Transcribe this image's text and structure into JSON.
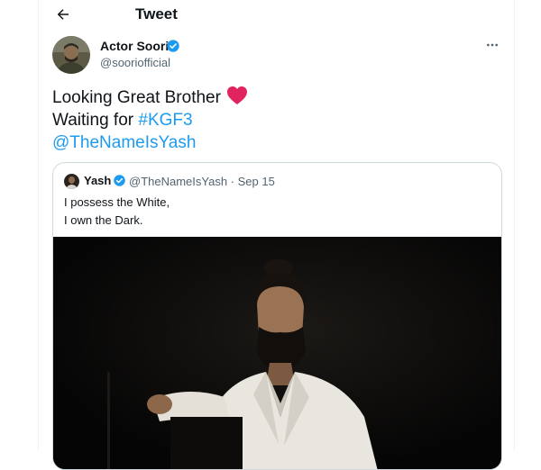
{
  "header": {
    "title": "Tweet",
    "back_icon": "arrow-left-icon"
  },
  "tweet": {
    "author_name": "Actor Soori",
    "author_handle": "@sooriofficial",
    "text_line1": "Looking Great Brother",
    "text_line2_prefix": "Waiting for ",
    "hashtag": "#KGF3",
    "mention": "@TheNameIsYash",
    "heart_emoji": "heart-icon",
    "more_icon": "more-horizontal-icon"
  },
  "quote": {
    "author_name": "Yash",
    "handle_and_date": "@TheNameIsYash · Sep 15",
    "text_line1": "I possess the White,",
    "text_line2": "I own the Dark."
  },
  "colors": {
    "accent": "#1d9bf0",
    "text": "#0f1419",
    "muted": "#536471",
    "heart": "#e0245e",
    "border": "#cfd9de"
  }
}
